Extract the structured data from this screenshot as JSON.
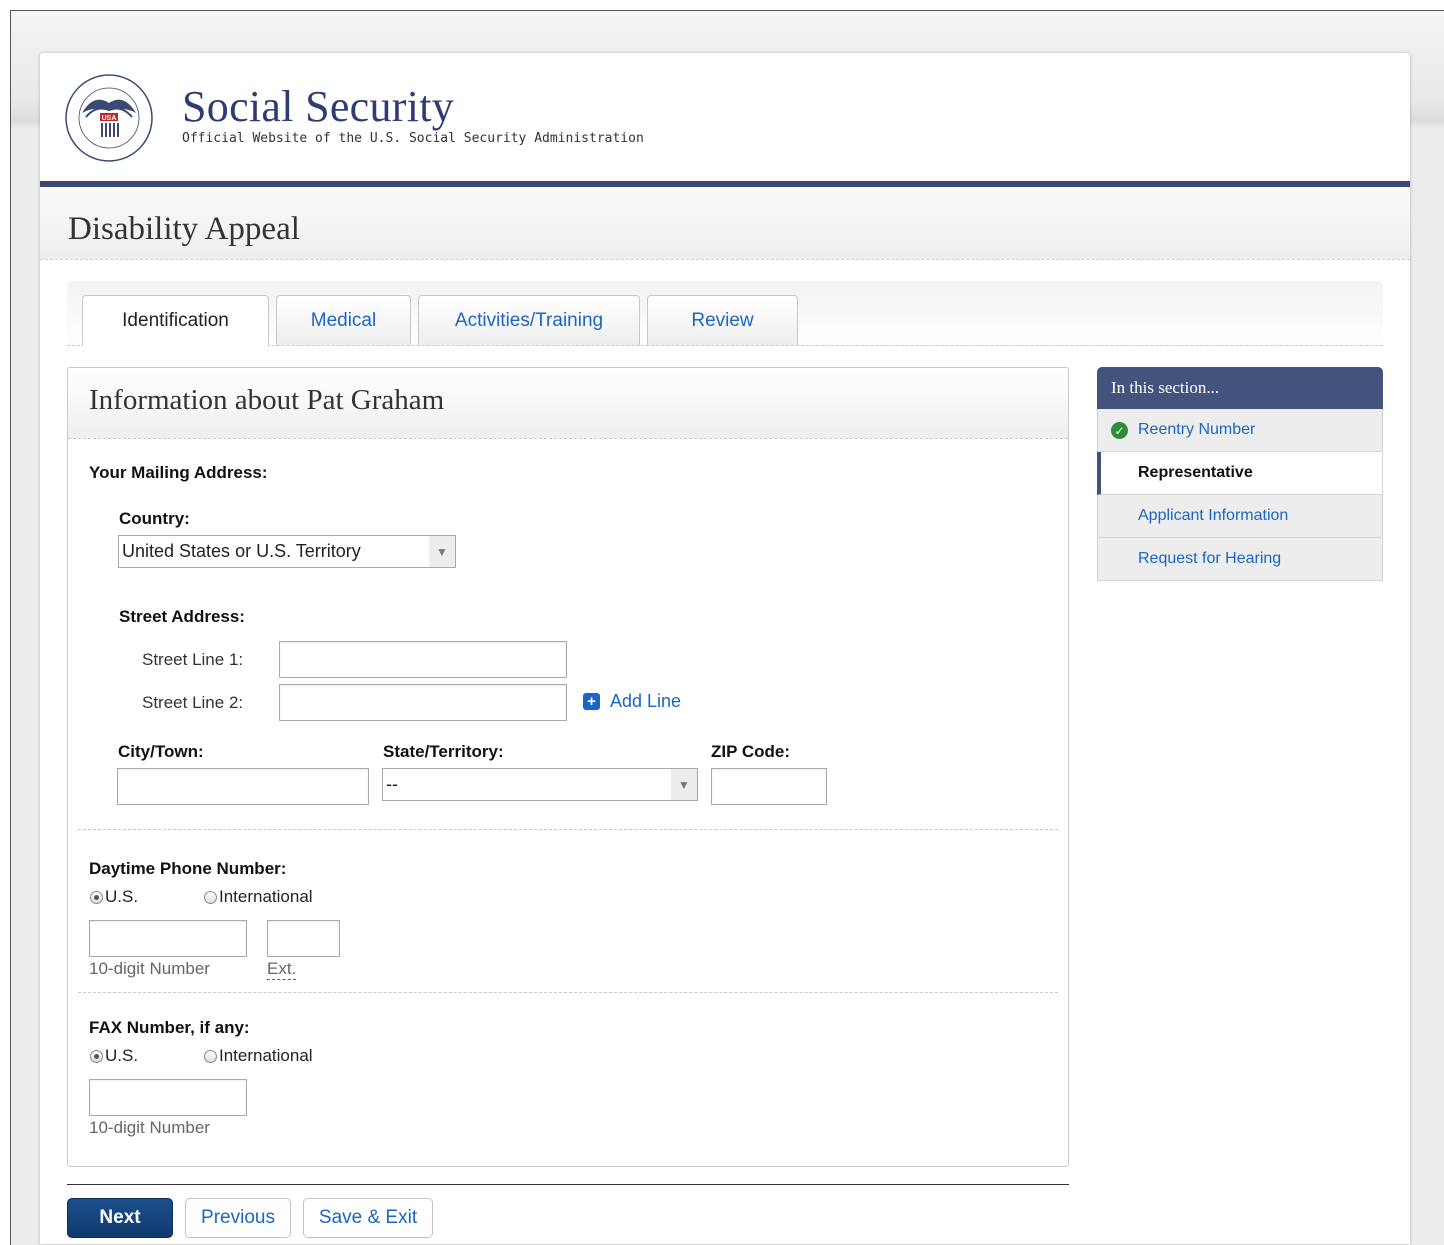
{
  "site": {
    "title": "Social Security",
    "subtitle": "Official Website of the U.S. Social Security Administration",
    "logo_alt": "Social Security Administration seal"
  },
  "page": {
    "title": "Disability Appeal"
  },
  "tabs": [
    {
      "label": "Identification",
      "active": true
    },
    {
      "label": "Medical",
      "active": false
    },
    {
      "label": "Activities/Training",
      "active": false
    },
    {
      "label": "Review",
      "active": false
    }
  ],
  "panel": {
    "title": "Information about Pat Graham",
    "mailing_label": "Your Mailing Address:",
    "country_label": "Country:",
    "country_value": "United States or U.S. Territory",
    "street_label": "Street Address:",
    "street1_label": "Street Line 1:",
    "street1_value": "",
    "street2_label": "Street Line 2:",
    "street2_value": "",
    "add_line": "Add Line",
    "city_label": "City/Town:",
    "state_label": "State/Territory:",
    "state_value": "--",
    "zip_label": "ZIP Code:",
    "phone_label": "Daytime Phone Number:",
    "phone_us": "U.S.",
    "phone_intl": "International",
    "phone_hint": "10-digit Number",
    "ext_hint": "Ext.",
    "fax_label": "FAX Number, if any:",
    "fax_us": "U.S.",
    "fax_intl": "International",
    "fax_hint": "10-digit Number"
  },
  "sidebar": {
    "heading": "In this section...",
    "items": [
      {
        "label": "Reentry Number",
        "state": "completed"
      },
      {
        "label": "Representative",
        "state": "current"
      },
      {
        "label": "Applicant Information",
        "state": "link"
      },
      {
        "label": "Request for Hearing",
        "state": "link"
      }
    ]
  },
  "buttons": {
    "next": "Next",
    "previous": "Previous",
    "save_exit": "Save & Exit"
  },
  "colors": {
    "navy": "#3a4a72",
    "link": "#1a66c2",
    "check": "#2e8b3a"
  }
}
